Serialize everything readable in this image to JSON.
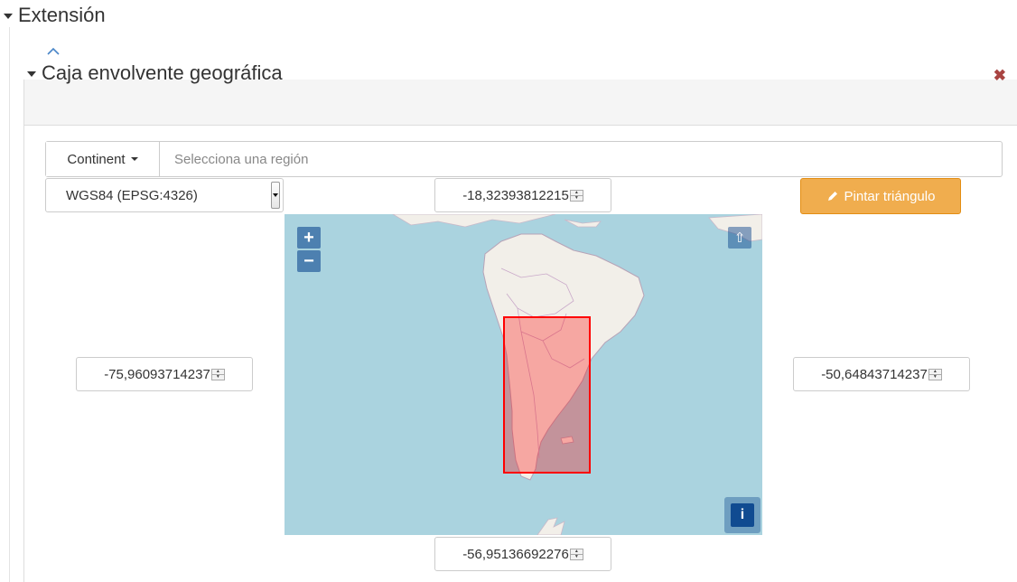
{
  "section": {
    "title": "Extensión",
    "caret_icon": "caret-down-icon"
  },
  "bbox_panel": {
    "collapse_icon": "chevron-up-icon",
    "title": "Caja envolvente geográfica",
    "remove_icon": "close-icon",
    "remove_color": "#a94442"
  },
  "region": {
    "continent_label": "Continent",
    "placeholder": "Selecciona una región"
  },
  "crs": {
    "selected": "WGS84 (EPSG:4326)"
  },
  "coords": {
    "north": "-18,32393812215",
    "south": "-56,95136692276",
    "west": "-75,96093714237",
    "east": "-50,64843714237"
  },
  "draw_button": {
    "label": "Pintar triángulo",
    "icon": "pencil-icon",
    "color": "#f0ad4e"
  },
  "map": {
    "zoom_in_label": "+",
    "zoom_out_label": "−",
    "reset_north_label": "⇧",
    "info_label": "i",
    "water_color": "#aad3df",
    "land_color": "#f2efe9",
    "selection_color": "#ff0000"
  }
}
